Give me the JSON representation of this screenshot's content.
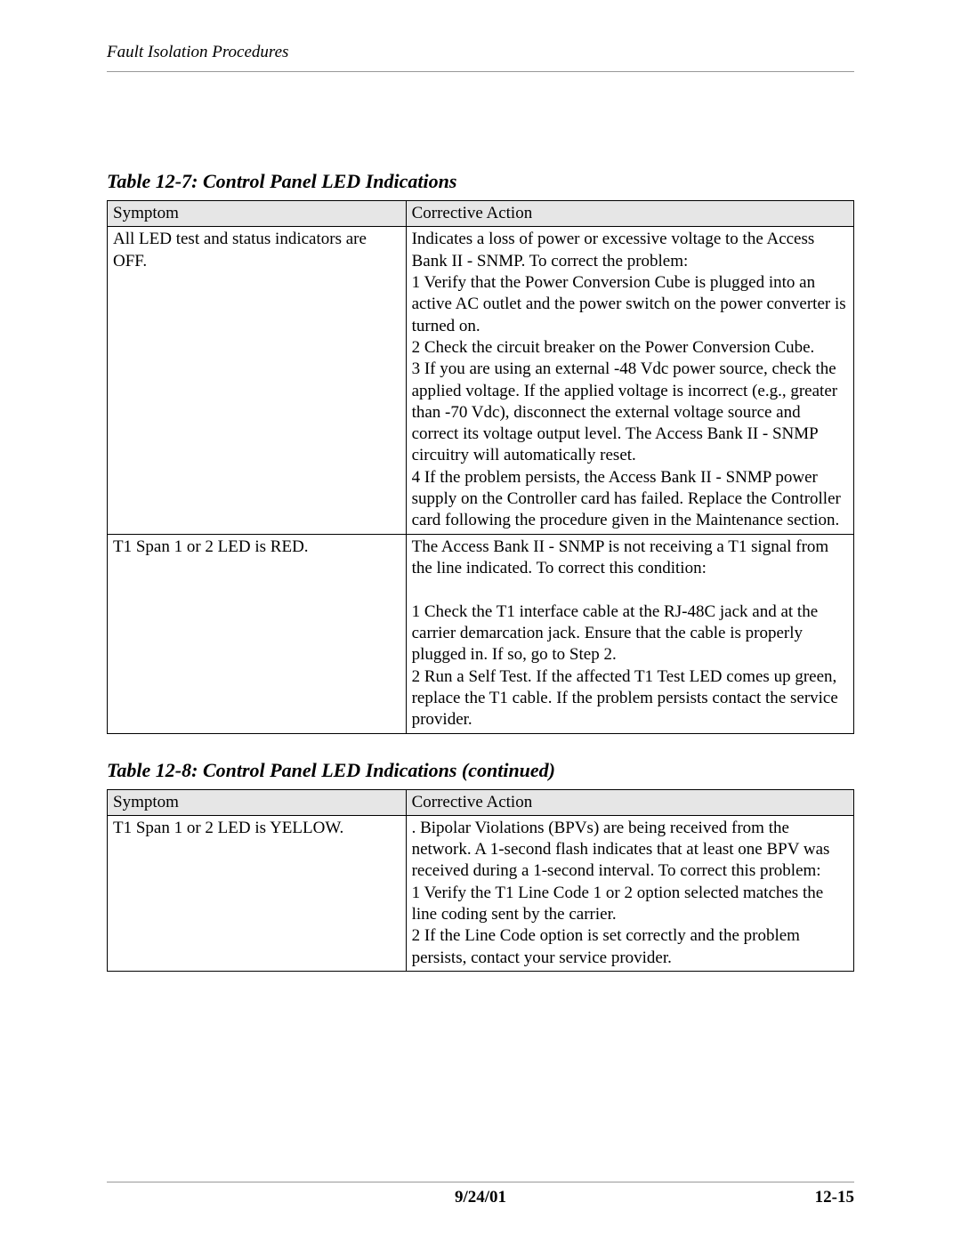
{
  "header": {
    "section_title": "Fault Isolation Procedures"
  },
  "table1": {
    "caption": "Table 12-7: Control Panel LED Indications",
    "headers": {
      "symptom": "Symptom",
      "action": "Corrective Action"
    },
    "rows": [
      {
        "symptom": "All LED test and status indicators are OFF.",
        "action": "Indicates a loss of power or excessive voltage to the Access Bank II - SNMP. To correct the problem:\n1  Verify that the Power Conversion Cube is plugged into an active AC outlet and the power switch on the power converter is turned on.\n2  Check the circuit breaker on the Power Conversion Cube.\n3  If you are using an external -48 Vdc power source, check the applied voltage. If the applied voltage is incorrect (e.g., greater than -70 Vdc), disconnect the external voltage source and correct its voltage output level. The Access Bank II - SNMP circuitry will automatically reset.\n4  If the problem persists, the Access Bank II - SNMP power supply on the Controller card has failed. Replace the Controller card following the procedure given in the Maintenance section."
      },
      {
        "symptom": "T1 Span 1 or 2 LED is RED.",
        "action": "The Access Bank II - SNMP is not receiving a T1 signal from the line indicated. To correct this condition:\n\n1  Check the T1 interface cable at the RJ-48C jack and at the carrier demarcation jack. Ensure that the cable is properly plugged in. If so, go to Step 2.\n2  Run a Self Test. If the affected T1 Test LED comes up green, replace the T1 cable. If the problem persists contact the service provider."
      }
    ]
  },
  "table2": {
    "caption": "Table 12-8: Control Panel LED Indications (continued)",
    "headers": {
      "symptom": "Symptom",
      "action": "Corrective Action"
    },
    "rows": [
      {
        "symptom": "T1 Span 1 or 2 LED is YELLOW.",
        "action": ". Bipolar Violations (BPVs) are being received from the network. A 1-second flash indicates that at least one BPV was received during a 1-second interval. To correct this problem:\n1 Verify the T1 Line Code 1 or 2 option selected matches the line coding sent by the carrier.\n2 If the Line Code option is set correctly and the problem persists, contact your service provider."
      }
    ]
  },
  "footer": {
    "date": "9/24/01",
    "page": "12-15"
  }
}
